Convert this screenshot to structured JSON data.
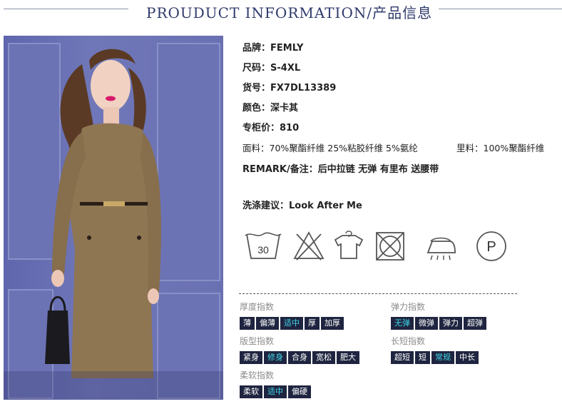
{
  "header": {
    "title": "PROUDUCT INFORMATION/产品信息"
  },
  "specs": {
    "brand": {
      "label": "品牌：",
      "value": "FEMLY"
    },
    "size": {
      "label": "尺码：",
      "value": "S-4XL"
    },
    "item_no": {
      "label": "货号：",
      "value": "FX7DL13389"
    },
    "color": {
      "label": "颜色：",
      "value": "深卡其"
    },
    "price": {
      "label": "专柜价：",
      "value": "810"
    },
    "fabric": {
      "label": "面料：",
      "value": "70%聚酯纤维 25%粘胶纤维 5%氨纶"
    },
    "lining": {
      "label": "里料：",
      "value": "100%聚酯纤维"
    },
    "remark": {
      "label": "REMARK/备注：",
      "value": "后中拉链 无弹 有里布 送腰带"
    },
    "wash": {
      "label": "洗涤建议：",
      "value": "Look After Me"
    }
  },
  "care_icons": [
    {
      "name": "wash-30-icon",
      "text": "30"
    },
    {
      "name": "no-bleach-icon"
    },
    {
      "name": "hang-dry-icon"
    },
    {
      "name": "no-tumble-dry-icon"
    },
    {
      "name": "iron-steam-icon"
    },
    {
      "name": "dry-clean-p-icon",
      "text": "P"
    }
  ],
  "indices": {
    "thickness": {
      "title": "厚度指数",
      "options": [
        "薄",
        "偏薄",
        "适中",
        "厚",
        "加厚"
      ],
      "active": "适中"
    },
    "elasticity": {
      "title": "弹力指数",
      "options": [
        "无弹",
        "微弹",
        "弹力",
        "超弹"
      ],
      "active": "无弹"
    },
    "fit": {
      "title": "版型指数",
      "options": [
        "紧身",
        "修身",
        "合身",
        "宽松",
        "肥大"
      ],
      "active": "修身"
    },
    "length": {
      "title": "长短指数",
      "options": [
        "超短",
        "短",
        "常规",
        "中长"
      ],
      "active": "常规"
    },
    "softness": {
      "title": "柔软指数",
      "options": [
        "柔软",
        "适中",
        "偏硬"
      ],
      "active": "适中"
    }
  },
  "colors": {
    "accent": "#3fd6e8",
    "tag_bg": "#1f2540",
    "title": "#2f3a6b"
  }
}
